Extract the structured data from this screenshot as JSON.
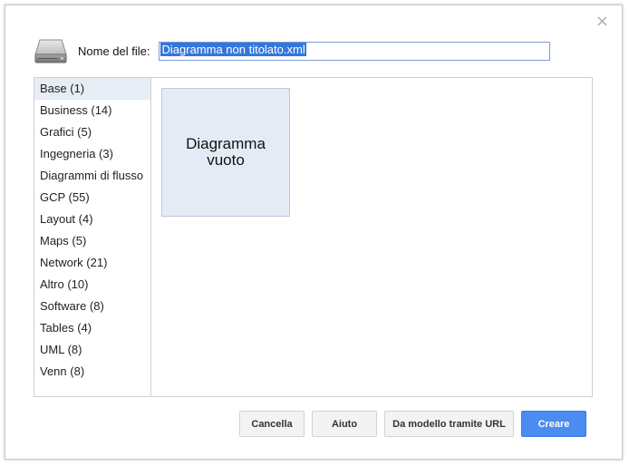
{
  "dialog": {
    "close_glyph": "×",
    "drive_icon": "hard-drive-icon"
  },
  "header": {
    "filename_label": "Nome del file:",
    "filename_value": "Diagramma non titolato.xml"
  },
  "categories": [
    {
      "label": "Base (1)",
      "selected": true
    },
    {
      "label": "Business (14)"
    },
    {
      "label": "Grafici (5)"
    },
    {
      "label": "Ingegneria (3)"
    },
    {
      "label": "Diagrammi di flusso"
    },
    {
      "label": "GCP (55)"
    },
    {
      "label": "Layout (4)"
    },
    {
      "label": "Maps (5)"
    },
    {
      "label": "Network (21)"
    },
    {
      "label": "Altro (10)"
    },
    {
      "label": "Software (8)"
    },
    {
      "label": "Tables (4)"
    },
    {
      "label": "UML (8)"
    },
    {
      "label": "Venn (8)"
    }
  ],
  "templates": [
    {
      "label": "Diagramma vuoto"
    }
  ],
  "buttons": {
    "cancel": "Cancella",
    "help": "Aiuto",
    "from_url": "Da modello tramite URL",
    "create": "Creare"
  },
  "colors": {
    "accent": "#4a8cf0",
    "selection": "#3377dd",
    "selected_category_bg": "#e7edf5",
    "template_tile_bg": "#e5ebf4"
  }
}
